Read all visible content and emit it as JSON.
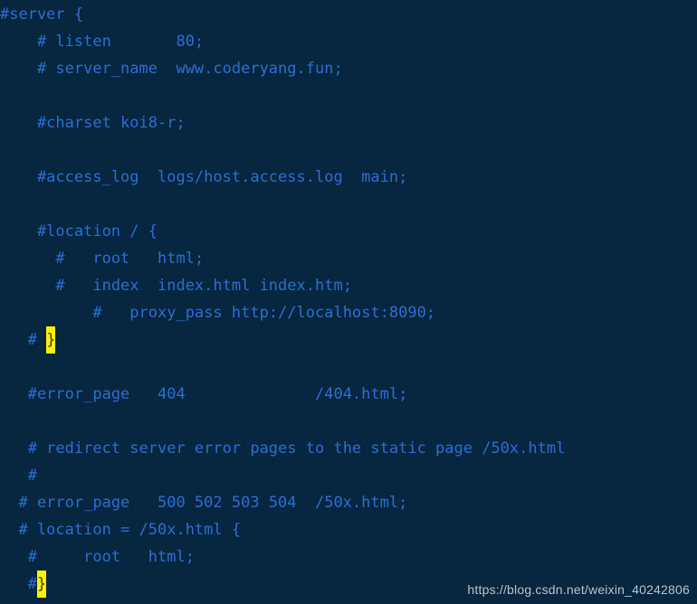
{
  "editor": {
    "background_color": "#07263f",
    "text_color": "#2b6fd4",
    "highlight_color": "#fff200",
    "highlight_text_color": "#3b3b1a",
    "language": "nginx-conf",
    "lines": [
      {
        "id": "line-1",
        "text": "#server {"
      },
      {
        "id": "line-2",
        "text": "    # listen       80;"
      },
      {
        "id": "line-3",
        "text": "    # server_name  www.coderyang.fun;"
      },
      {
        "id": "line-4",
        "text": ""
      },
      {
        "id": "line-5",
        "text": "    #charset koi8-r;"
      },
      {
        "id": "line-6",
        "text": ""
      },
      {
        "id": "line-7",
        "text": "    #access_log  logs/host.access.log  main;"
      },
      {
        "id": "line-8",
        "text": ""
      },
      {
        "id": "line-9",
        "text": "    #location / {"
      },
      {
        "id": "line-10",
        "text": "      #   root   html;"
      },
      {
        "id": "line-11",
        "text": "      #   index  index.html index.htm;"
      },
      {
        "id": "line-12",
        "text": "          #   proxy_pass http://localhost:8090;"
      },
      {
        "id": "line-13",
        "pre": "   # ",
        "highlight": "}",
        "post": ""
      },
      {
        "id": "line-14",
        "text": ""
      },
      {
        "id": "line-15",
        "text": "   #error_page   404              /404.html;"
      },
      {
        "id": "line-16",
        "text": ""
      },
      {
        "id": "line-17",
        "text": "   # redirect server error pages to the static page /50x.html"
      },
      {
        "id": "line-18",
        "text": "   #"
      },
      {
        "id": "line-19",
        "text": "  # error_page   500 502 503 504  /50x.html;"
      },
      {
        "id": "line-20",
        "text": "  # location = /50x.html {"
      },
      {
        "id": "line-21",
        "text": "   #     root   html;"
      },
      {
        "id": "line-22",
        "pre": "   #",
        "highlight": "}",
        "post": ""
      }
    ]
  },
  "watermark": {
    "text": "https://blog.csdn.net/weixin_40242806"
  }
}
